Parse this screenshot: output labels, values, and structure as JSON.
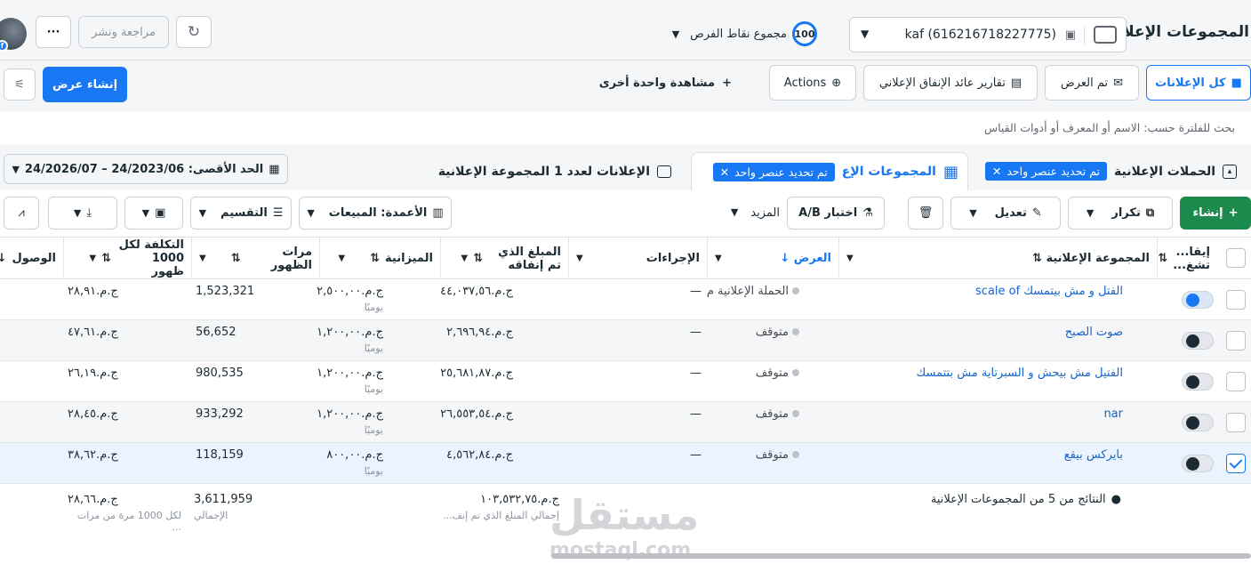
{
  "header": {
    "title": "المجموعات الإعلانية",
    "account": "kaf (616216718227775)",
    "opportunity_score": "100",
    "opportunity_label": "مجموع نقاط الفرص",
    "review_publish": "مراجعة ونشر",
    "more": "···"
  },
  "views": {
    "all_ads": "كل الإعلانات",
    "shown": "تم العرض",
    "roas_reports": "تقارير عائد الإنفاق الإعلاني",
    "actions": "Actions",
    "more_views": "مشاهدة واحدة أخرى",
    "create_view": "إنشاء عرض"
  },
  "search": {
    "placeholder": "بحث للفلترة حسب: الاسم أو المعرف أو أدوات القياس"
  },
  "tabs": {
    "campaigns": "الحملات الإعلانية",
    "campaigns_chip": "تم تحديد عنصر واحد",
    "adsets": "المجموعات الإع",
    "adsets_chip": "تم تحديد عنصر واحد",
    "ads": "الإعلانات لعدد 1 المجموعة الإعلانية",
    "daterange": "الحد الأقصى: 24/2023/06 – 24/2026/07"
  },
  "toolbar": {
    "create": "إنشاء",
    "duplicate": "تكرار",
    "edit": "تعديل",
    "ab_test": "اختبار A/B",
    "more": "المزيد",
    "columns": "الأعمدة: المبيعات",
    "breakdown": "التقسيم"
  },
  "columns": {
    "onoff": "إيقا... تشغ...",
    "adset": "المجموعة الإعلانية",
    "delivery": "العرض",
    "actions": "الإجراءات",
    "spent": "المبلغ الذي تم إنفاقه",
    "budget": "الميزانية",
    "impressions": "مرات الظهور",
    "cpm": "التكلفة لكل 1000 ظهور",
    "reach": "الوصول"
  },
  "rows": [
    {
      "name": "الفتل و مش بيتمسك scale of",
      "delivery": "الحملة الإعلانية م",
      "actions": "—",
      "spent": "ج.م.٤٤,٠٣٧,٥٦",
      "budget": "ج.م.٢,٥٠٠,٠٠",
      "budget_sub": "يوميًا",
      "impressions": "1,523,321",
      "cpm": "ج.م.٢٨,٩١",
      "on": true,
      "checked": false
    },
    {
      "name": "صوت الصبح",
      "delivery": "متوقف",
      "actions": "—",
      "spent": "ج.م.٢,٦٩٦,٩٤",
      "budget": "ج.م.١,٢٠٠,٠٠",
      "budget_sub": "يوميًا",
      "impressions": "56,652",
      "cpm": "ج.م.٤٧,٦١",
      "on": false,
      "checked": false
    },
    {
      "name": "الفتيل مش بيحش و السبرتاية مش بتتمسك",
      "delivery": "متوقف",
      "actions": "—",
      "spent": "ج.م.٢٥,٦٨١,٨٧",
      "budget": "ج.م.١,٢٠٠,٠٠",
      "budget_sub": "يوميًا",
      "impressions": "980,535",
      "cpm": "ج.م.٢٦,١٩",
      "on": false,
      "checked": false
    },
    {
      "name": "nar",
      "delivery": "متوقف",
      "actions": "—",
      "spent": "ج.م.٢٦,٥٥٣,٥٤",
      "budget": "ج.م.١,٢٠٠,٠٠",
      "budget_sub": "يوميًا",
      "impressions": "933,292",
      "cpm": "ج.م.٢٨,٤٥",
      "on": false,
      "checked": false
    },
    {
      "name": "بايركس بيقع",
      "delivery": "متوقف",
      "actions": "—",
      "spent": "ج.م.٤,٥٦٢,٨٤",
      "budget": "ج.م.٨٠٠,٠٠",
      "budget_sub": "يوميًا",
      "impressions": "118,159",
      "cpm": "ج.م.٣٨,٦٢",
      "on": false,
      "checked": true
    }
  ],
  "totals": {
    "label": "النتائج من 5 من المجموعات الإعلانية",
    "spent": "ج.م.١٠٣,٥٣٢,٧٥",
    "spent_sub": "إجمالي المبلغ الذي تم إنف...",
    "impressions": "3,611,959",
    "impressions_sub": "الإجمالي",
    "cpm": "ج.م.٢٨,٦٦",
    "cpm_sub": "لكل 1000 مرة من مرات ..."
  },
  "watermark": {
    "ar": "مستقل",
    "en": "mostaql.com"
  }
}
